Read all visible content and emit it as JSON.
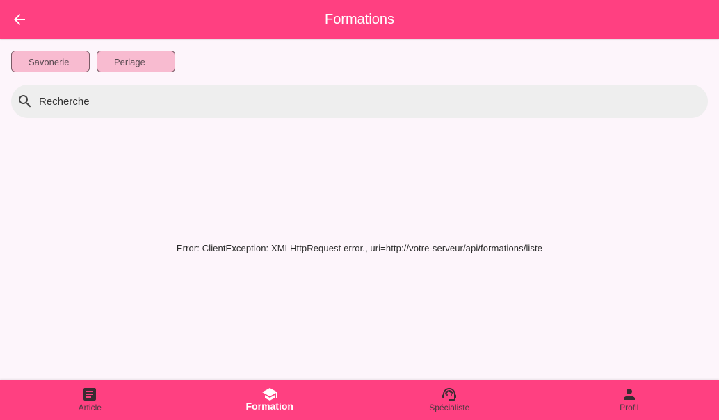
{
  "appbar": {
    "title": "Formations",
    "background": "#ff4081"
  },
  "chips": [
    {
      "label": "Savonerie"
    },
    {
      "label": "Perlage"
    }
  ],
  "search": {
    "placeholder": "Recherche",
    "value": ""
  },
  "error": {
    "message": "Error: ClientException: XMLHttpRequest error., uri=http://votre-serveur/api/formations/liste"
  },
  "bottom_nav": {
    "items": [
      {
        "label": "Article",
        "icon": "article-icon"
      },
      {
        "label": "Formation",
        "icon": "school-icon",
        "active": true
      },
      {
        "label": "Spécialiste",
        "icon": "support-agent-icon"
      },
      {
        "label": "Profil",
        "icon": "person-icon"
      }
    ]
  },
  "colors": {
    "primary": "#ff4081",
    "chip": "#f8bbd0",
    "background": "#fdf5fb",
    "search_bg": "#eeeeee"
  }
}
